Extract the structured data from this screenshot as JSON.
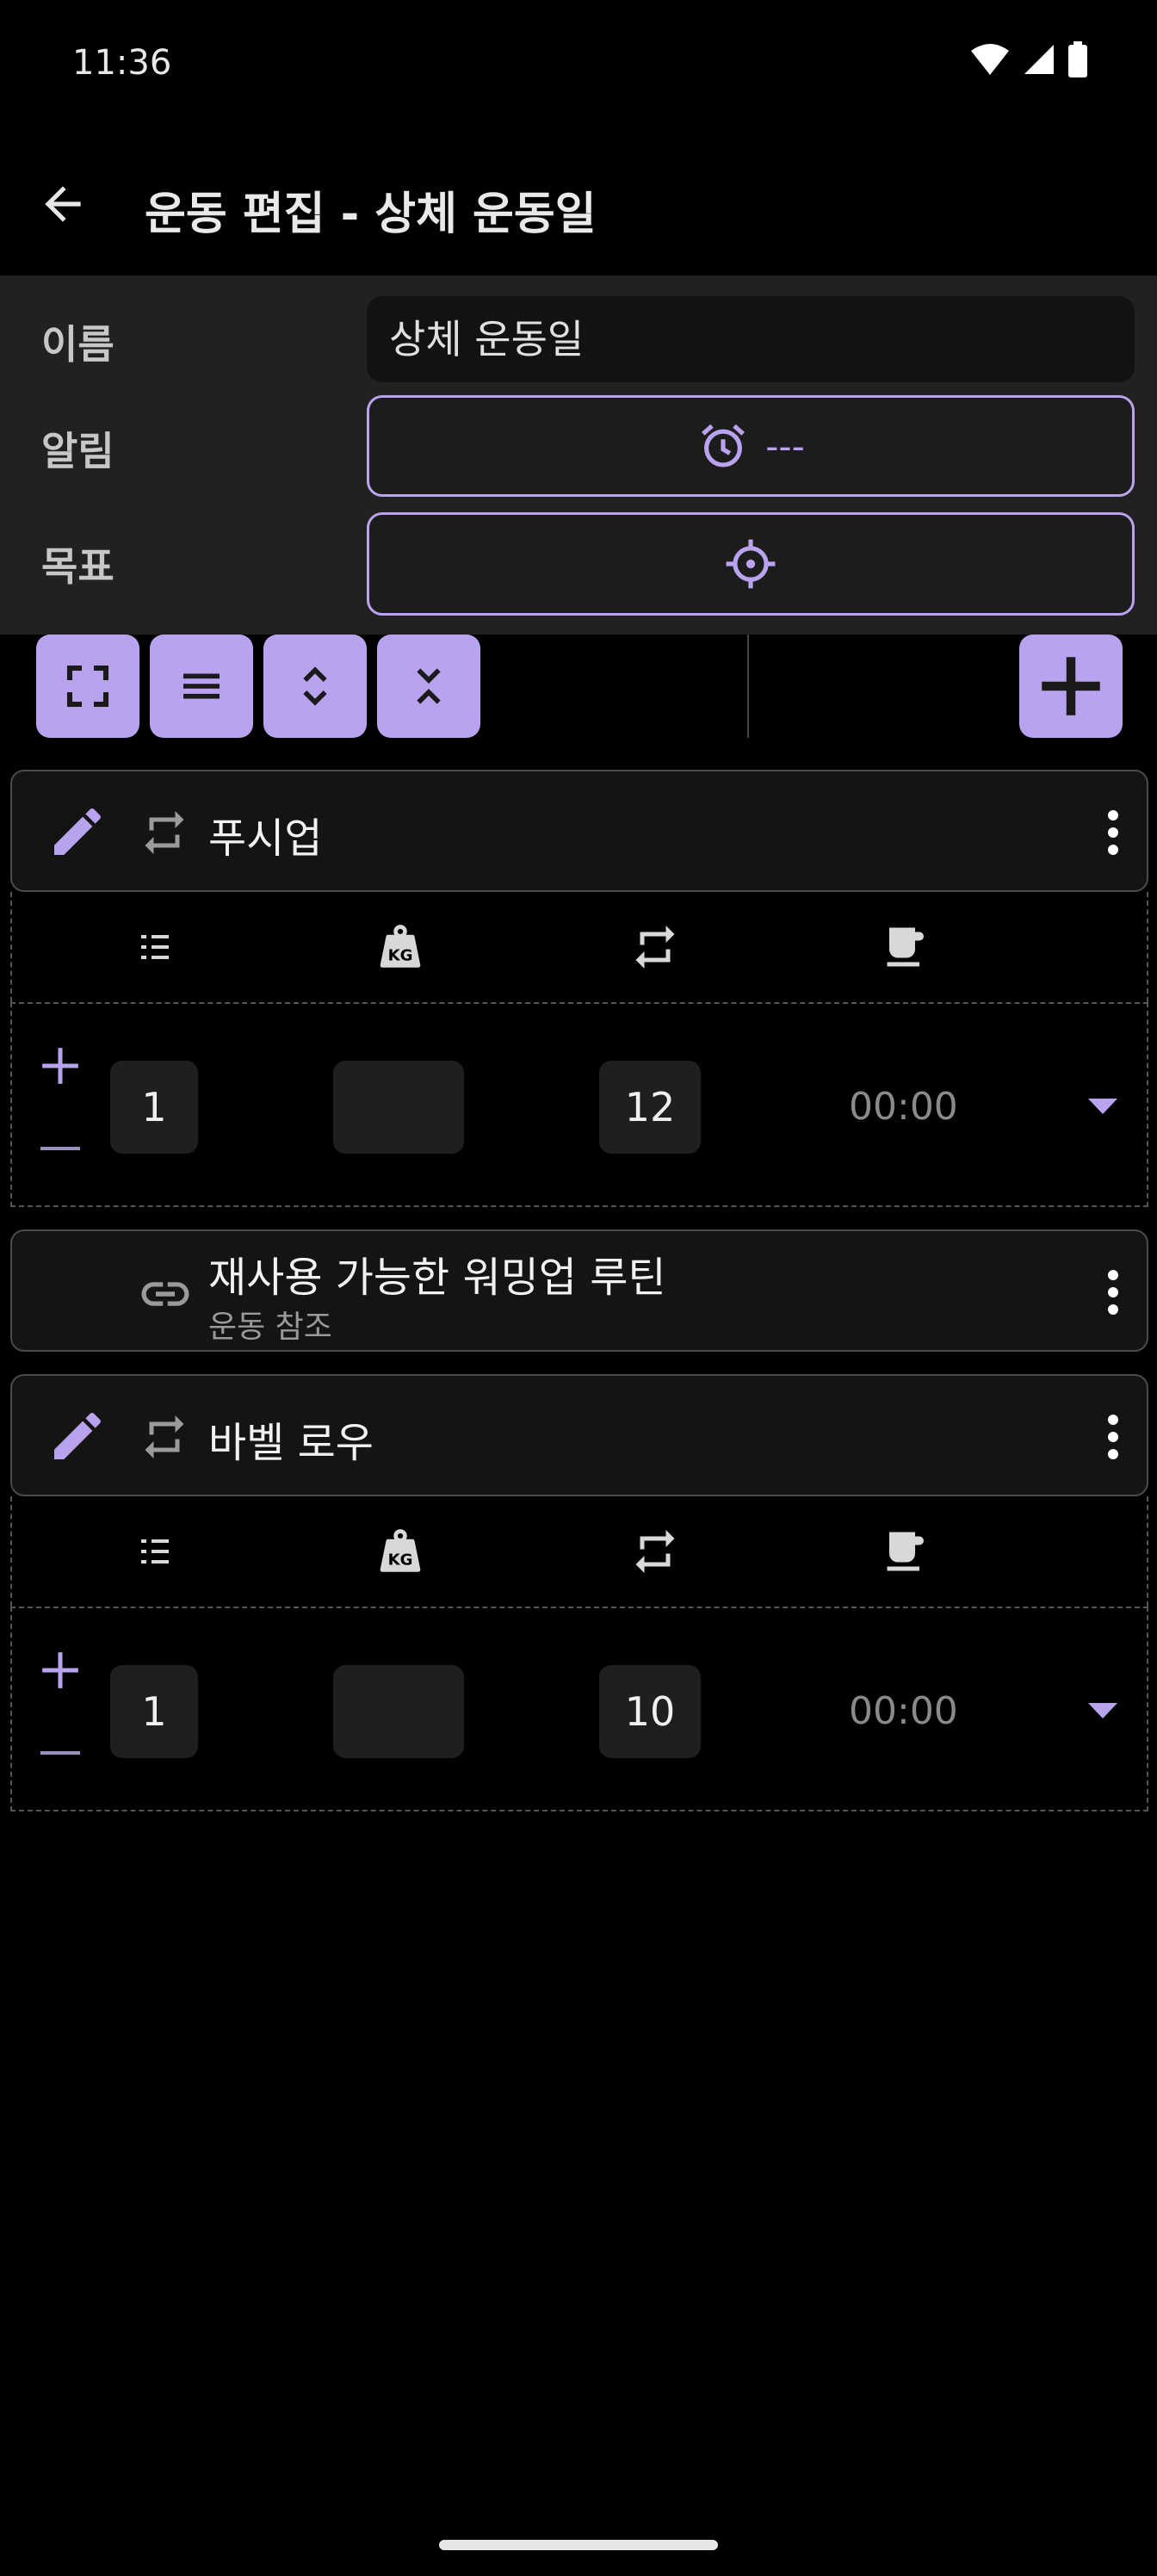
{
  "status_bar": {
    "time": "11:36"
  },
  "app_bar": {
    "title": "운동 편집 - 상체 운동일"
  },
  "form": {
    "name_label": "이름",
    "name_value": "상체 운동일",
    "alarm_label": "알림",
    "alarm_value": "---",
    "target_label": "목표"
  },
  "exercises": [
    {
      "name": "푸시업",
      "sets": [
        {
          "set": "1",
          "weight": "",
          "reps": "12",
          "rest": "00:00"
        }
      ]
    },
    {
      "name": "재사용 가능한 워밍업 루틴",
      "subtitle": "운동 참조"
    },
    {
      "name": "바벨 로우",
      "sets": [
        {
          "set": "1",
          "weight": "",
          "reps": "10",
          "rest": "00:00"
        }
      ]
    }
  ],
  "colors": {
    "accent": "#b9a3ee",
    "background": "#000000",
    "panel": "#212121",
    "card": "#141414"
  }
}
